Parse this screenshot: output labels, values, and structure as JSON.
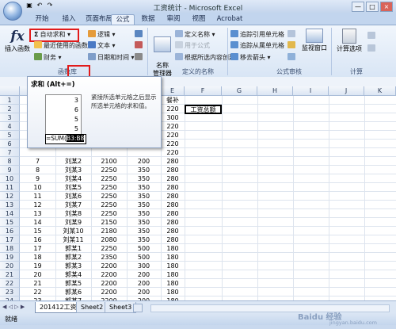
{
  "window": {
    "title": "工资统计 - Microsoft Excel",
    "qat_icons": [
      "save-icon",
      "undo-icon",
      "redo-icon"
    ],
    "controls": [
      "—",
      "□",
      "×"
    ]
  },
  "ribbon_tabs": [
    "开始",
    "插入",
    "页面布局",
    "公式",
    "数据",
    "审阅",
    "视图",
    "Acrobat"
  ],
  "ribbon": {
    "insert_function": "插入函数",
    "autosum": "自动求和",
    "recent": "最近使用的函数",
    "finance": "财务",
    "logic": "逻辑",
    "text": "文本",
    "datetime": "日期和时间",
    "function_library_label": "函数库",
    "name_manager": "名称\n管理器",
    "define_name": "定义名称",
    "use_in_formula": "用于公式",
    "create_from_selection": "根据所选内容创建",
    "defined_names_label": "定义的名称",
    "trace_precedents": "追踪引用单元格",
    "trace_dependents": "追踪从属单元格",
    "remove_arrows": "移去箭头",
    "watch_window": "监视窗口",
    "calc_options": "计算选项",
    "formula_auditing_label": "公式审核",
    "calculation_label": "计算"
  },
  "tooltip": {
    "title": "求和 (Alt+=)",
    "numbers": [
      "3",
      "6",
      "5",
      "5"
    ],
    "formula_prefix": "=SUM(",
    "formula_range": "B3:B8",
    "description": "紧接所选单元格之后显示所选单元格的求和值。"
  },
  "grid": {
    "columns": [
      "E",
      "F",
      "G",
      "H",
      "I",
      "J",
      "K"
    ],
    "col_e_header": "餐补",
    "f2_value": "工资总额",
    "rows": [
      {
        "n": "2",
        "id": "",
        "name": "",
        "b": "",
        "c": "",
        "e": "220"
      },
      {
        "n": "3",
        "id": "",
        "name": "",
        "b": "",
        "c": "",
        "e": "300"
      },
      {
        "n": "4",
        "id": "",
        "name": "",
        "b": "",
        "c": "",
        "e": "220"
      },
      {
        "n": "5",
        "id": "",
        "name": "",
        "b": "",
        "c": "",
        "e": "220"
      },
      {
        "n": "6",
        "id": "",
        "name": "",
        "b": "",
        "c": "",
        "e": "220"
      },
      {
        "n": "7",
        "id": "",
        "name": "",
        "b": "",
        "c": "",
        "e": "220"
      },
      {
        "n": "8",
        "id": "7",
        "name": "刘某2",
        "b": "2100",
        "c": "200",
        "e": "280"
      },
      {
        "n": "9",
        "id": "8",
        "name": "刘某3",
        "b": "2250",
        "c": "350",
        "e": "280"
      },
      {
        "n": "10",
        "id": "9",
        "name": "刘某4",
        "b": "2250",
        "c": "350",
        "e": "280"
      },
      {
        "n": "11",
        "id": "10",
        "name": "刘某5",
        "b": "2250",
        "c": "350",
        "e": "280"
      },
      {
        "n": "12",
        "id": "11",
        "name": "刘某6",
        "b": "2250",
        "c": "350",
        "e": "280"
      },
      {
        "n": "13",
        "id": "12",
        "name": "刘某7",
        "b": "2250",
        "c": "350",
        "e": "280"
      },
      {
        "n": "14",
        "id": "13",
        "name": "刘某8",
        "b": "2250",
        "c": "350",
        "e": "280"
      },
      {
        "n": "15",
        "id": "14",
        "name": "刘某9",
        "b": "2150",
        "c": "350",
        "e": "280"
      },
      {
        "n": "16",
        "id": "15",
        "name": "刘某10",
        "b": "2180",
        "c": "350",
        "e": "280"
      },
      {
        "n": "17",
        "id": "16",
        "name": "刘某11",
        "b": "2080",
        "c": "350",
        "e": "280"
      },
      {
        "n": "18",
        "id": "17",
        "name": "郭某1",
        "b": "2250",
        "c": "500",
        "e": "180"
      },
      {
        "n": "19",
        "id": "18",
        "name": "郭某2",
        "b": "2350",
        "c": "500",
        "e": "180"
      },
      {
        "n": "20",
        "id": "19",
        "name": "郭某3",
        "b": "2200",
        "c": "300",
        "e": "180"
      },
      {
        "n": "21",
        "id": "20",
        "name": "郭某4",
        "b": "2200",
        "c": "200",
        "e": "180"
      },
      {
        "n": "22",
        "id": "21",
        "name": "郭某5",
        "b": "2200",
        "c": "200",
        "e": "180"
      },
      {
        "n": "23",
        "id": "22",
        "name": "郭某6",
        "b": "2200",
        "c": "200",
        "e": "180"
      },
      {
        "n": "24",
        "id": "23",
        "name": "郭某7",
        "b": "2200",
        "c": "200",
        "e": "180"
      }
    ]
  },
  "sheet_tabs": [
    "201412工资",
    "Sheet2",
    "Sheet3"
  ],
  "status": {
    "ready": "就绪",
    "watermark": "Baidu 经验",
    "watermark_sub": "jingyan.baidu.com"
  }
}
